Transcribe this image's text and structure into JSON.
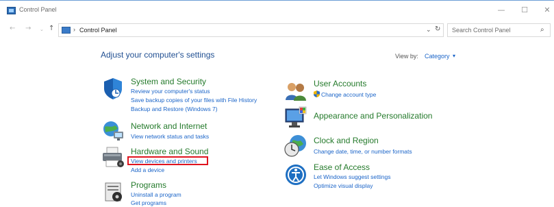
{
  "window": {
    "title": "Control Panel",
    "minimize": "—",
    "maximize": "☐",
    "close": "✕"
  },
  "nav": {
    "back": "←",
    "forward": "→",
    "recent": "⌄",
    "up": "↑",
    "address_separator": "›",
    "address": "Control Panel",
    "dropdown": "⌄",
    "refresh": "↻",
    "search_placeholder": "Search Control Panel",
    "search_icon": "⌕"
  },
  "main": {
    "heading": "Adjust your computer's settings",
    "view_by_label": "View by:",
    "view_by_value": "Category",
    "view_by_caret": "▾"
  },
  "categories": {
    "system": {
      "title": "System and Security",
      "icon": "shield-icon",
      "links": [
        "Review your computer's status",
        "Save backup copies of your files with File History",
        "Backup and Restore (Windows 7)"
      ]
    },
    "network": {
      "title": "Network and Internet",
      "icon": "globe-network-icon",
      "links": [
        "View network status and tasks"
      ]
    },
    "hardware": {
      "title": "Hardware and Sound",
      "icon": "printer-speaker-icon",
      "links": [
        "View devices and printers",
        "Add a device"
      ]
    },
    "programs": {
      "title": "Programs",
      "icon": "programs-icon",
      "links": [
        "Uninstall a program",
        "Get programs"
      ]
    },
    "user": {
      "title": "User Accounts",
      "icon": "users-icon",
      "links": [
        "Change account type"
      ]
    },
    "appearance": {
      "title": "Appearance and Personalization",
      "icon": "monitor-palette-icon",
      "links": []
    },
    "clock": {
      "title": "Clock and Region",
      "icon": "clock-globe-icon",
      "links": [
        "Change date, time, or number formats"
      ]
    },
    "ease": {
      "title": "Ease of Access",
      "icon": "ease-of-access-icon",
      "links": [
        "Let Windows suggest settings",
        "Optimize visual display"
      ]
    }
  },
  "colors": {
    "link": "#1a64c8",
    "category_title": "#247a2b",
    "heading": "#1f4e91",
    "highlight": "#e0141e"
  }
}
